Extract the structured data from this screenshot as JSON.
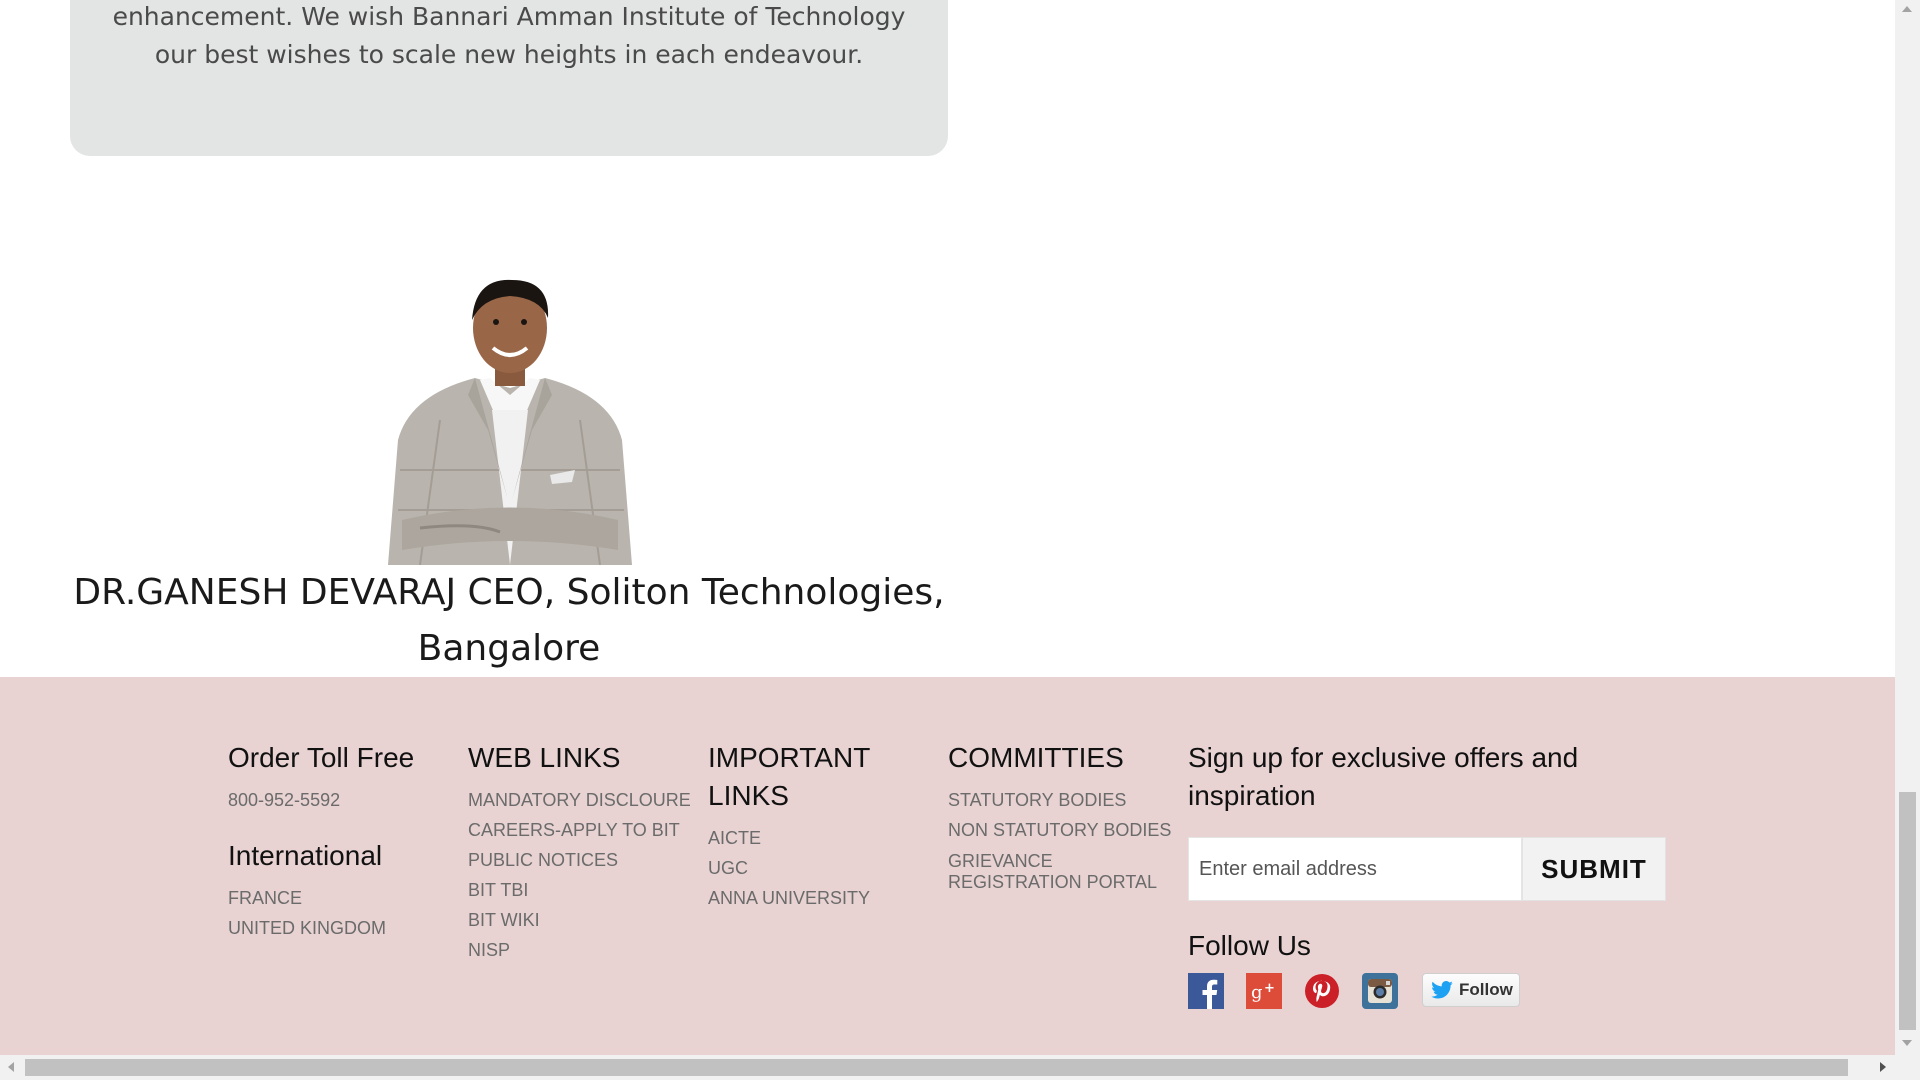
{
  "testimonial": {
    "line1": "enhancement. We wish Bannari Amman Institute of Technology",
    "line2": "our best wishes to scale new heights in each endeavour."
  },
  "person": {
    "caption": "DR.GANESH DEVARAJ CEO, Soliton Technologies, Bangalore"
  },
  "footer": {
    "toll_free": {
      "title": "Order Toll Free",
      "number": "800-952-5592"
    },
    "international": {
      "title": "International",
      "items": [
        "FRANCE",
        "UNITED KINGDOM"
      ]
    },
    "web_links": {
      "title": "WEB LINKS",
      "items": [
        "MANDATORY DISCLOURE",
        "CAREERS-APPLY TO BIT",
        "PUBLIC NOTICES",
        "BIT TBI",
        "BIT WIKI",
        "NISP"
      ]
    },
    "important_links": {
      "title_line1": "IMPORTANT",
      "title_line2": "LINKS",
      "items": [
        "AICTE",
        "UGC",
        "ANNA UNIVERSITY"
      ]
    },
    "committees": {
      "title": "COMMITTIES",
      "items": [
        "STATUTORY BODIES",
        "NON STATUTORY BODIES",
        "GRIEVANCE REGISTRATION PORTAL"
      ]
    },
    "signup": {
      "title": "Sign up for exclusive offers and inspiration",
      "placeholder": "Enter email address",
      "submit_label": "SUBMIT"
    },
    "follow": {
      "title": "Follow Us",
      "icons": [
        "facebook-icon",
        "google-plus-icon",
        "pinterest-icon",
        "instagram-icon"
      ],
      "twitter_label": "Follow"
    }
  },
  "colors": {
    "footer_bg": "#e8d2d2",
    "card_bg": "#e3e4e4",
    "facebook": "#3b5998",
    "google_plus": "#dd4b39",
    "pinterest": "#cb2027",
    "instagram": "#3f729b",
    "twitter": "#1da1f2"
  }
}
